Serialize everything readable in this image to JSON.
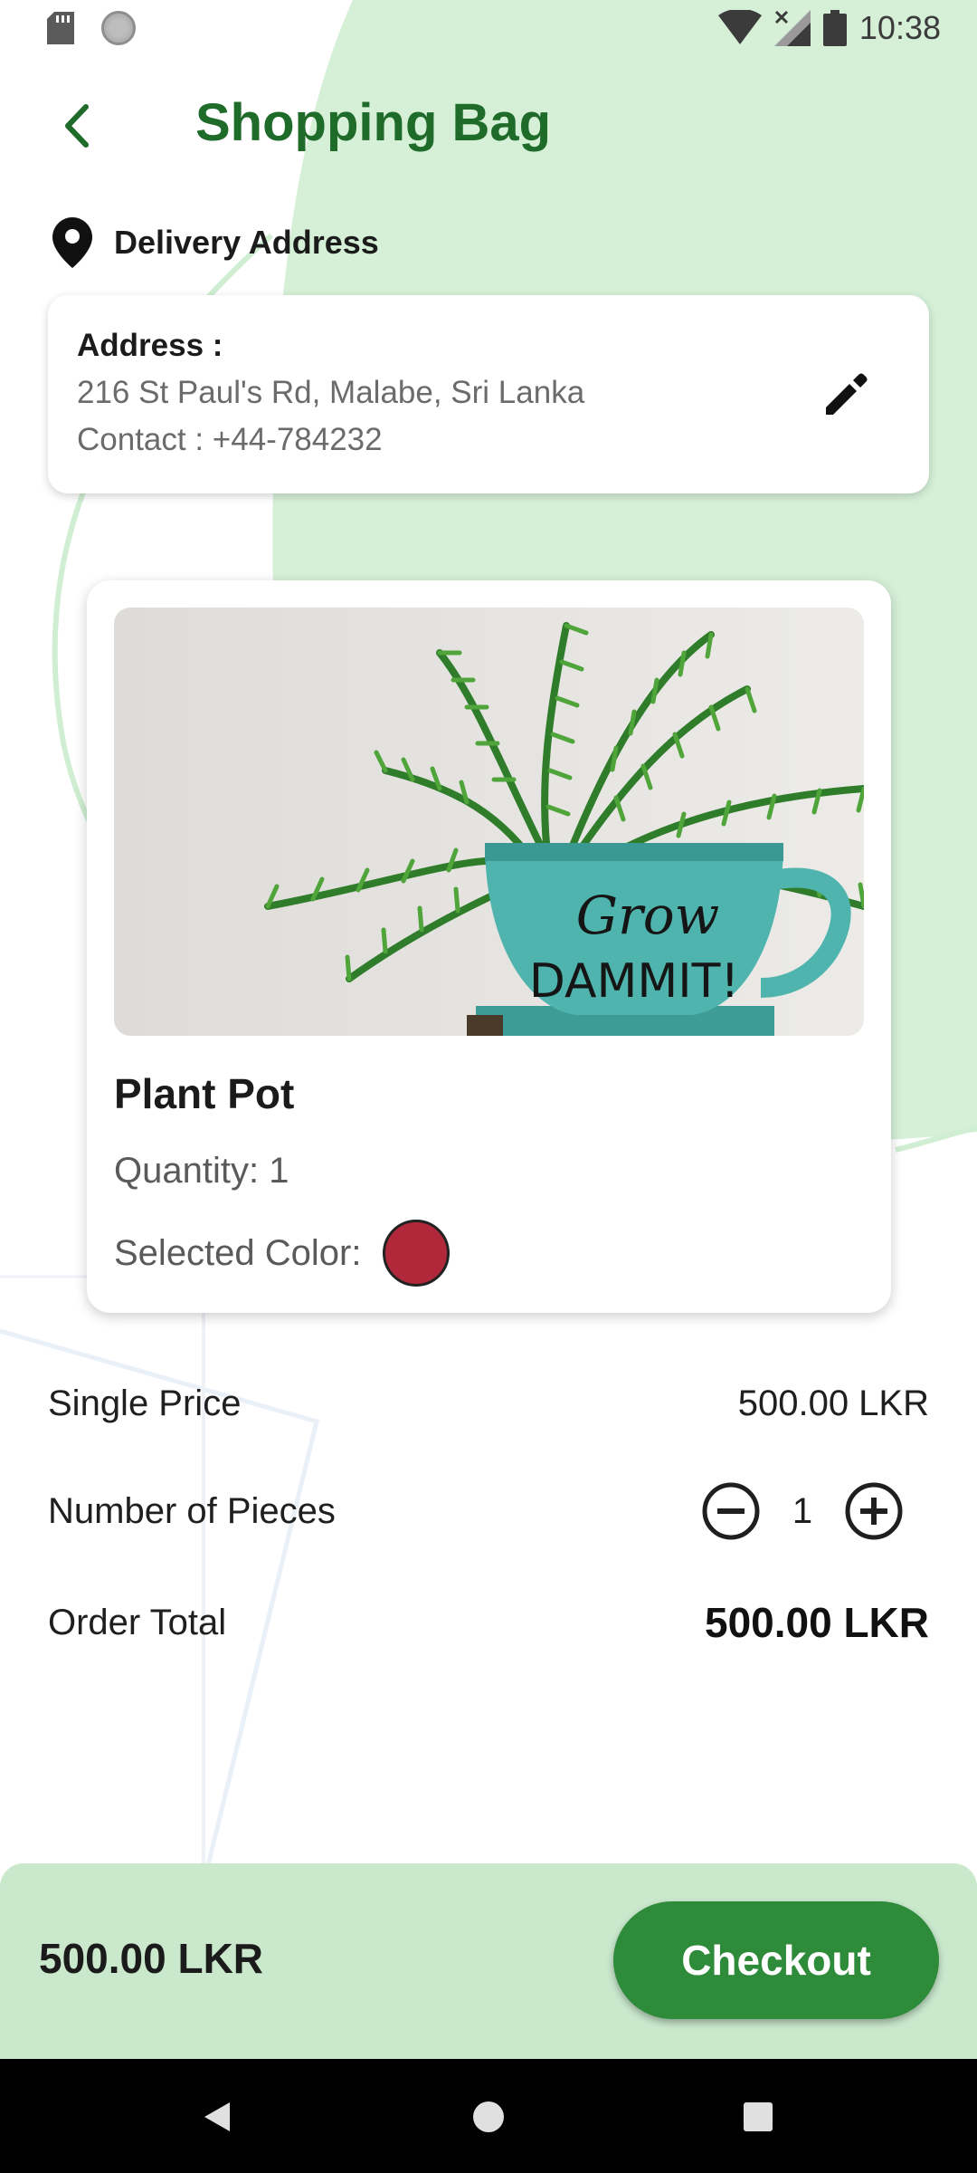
{
  "status_bar": {
    "time": "10:38",
    "icons": [
      "sd-card-icon",
      "sync-icon",
      "wifi-icon",
      "signal-icon",
      "battery-icon"
    ]
  },
  "header": {
    "title": "Shopping Bag",
    "back_icon": "back-arrow-icon"
  },
  "delivery": {
    "label": "Delivery Address",
    "icon": "location-pin-icon"
  },
  "address_card": {
    "title": "Address :",
    "address": "216 St Paul's Rd, Malabe, Sri Lanka",
    "contact": "Contact : +44-784232",
    "edit_icon": "edit-pencil-icon"
  },
  "product": {
    "name": "Plant Pot",
    "quantity_text": "Quantity: 1",
    "color_label": "Selected Color:",
    "selected_color": "#b0283a",
    "image_text_line1": "Grow",
    "image_text_line2": "DAMMIT!"
  },
  "summary": {
    "single_price_label": "Single Price",
    "single_price_value": "500.00 LKR",
    "pieces_label": "Number of Pieces",
    "pieces_value": "1",
    "order_total_label": "Order Total",
    "order_total_value": "500.00 LKR"
  },
  "checkout_bar": {
    "total": "500.00 LKR",
    "button_label": "Checkout"
  },
  "colors": {
    "brand_green": "#1e6b2a",
    "button_green": "#2e8b3a",
    "bar_bg": "#c9e8cc",
    "accent_bg": "#d6f0d8"
  }
}
